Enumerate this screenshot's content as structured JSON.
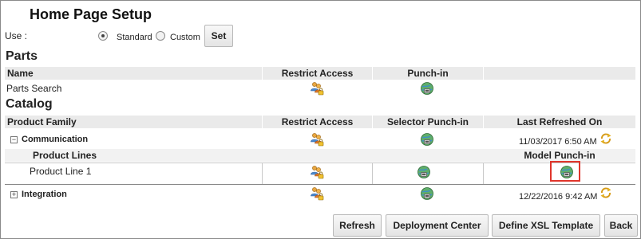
{
  "header": {
    "title": "Home Page Setup"
  },
  "use_row": {
    "label": "Use :",
    "options": [
      {
        "label": "Standard",
        "selected": true
      },
      {
        "label": "Custom",
        "selected": false
      }
    ],
    "set_label": "Set"
  },
  "parts": {
    "title": "Parts",
    "columns": [
      "Name",
      "Restrict Access",
      "Punch-in"
    ],
    "rows": [
      {
        "name": "Parts Search"
      }
    ]
  },
  "catalog": {
    "title": "Catalog",
    "columns": [
      "Product Family",
      "Restrict Access",
      "Selector Punch-in",
      "Last Refreshed On"
    ],
    "families": [
      {
        "name": "Communication",
        "expanded": true,
        "last_refreshed": "11/03/2017 6:50 AM",
        "sub_columns": [
          "Product Lines",
          "Model Punch-in"
        ],
        "lines": [
          {
            "name": "Product Line 1"
          }
        ]
      },
      {
        "name": "Integration",
        "expanded": false,
        "last_refreshed": "12/22/2016 9:42 AM"
      }
    ]
  },
  "buttons": {
    "refresh": "Refresh",
    "deployment_center": "Deployment Center",
    "define_xsl_template": "Define XSL Template",
    "back": "Back"
  },
  "icons": {
    "restrict_access": "users-lock-icon",
    "punch_in": "globe-punch-in-icon",
    "refresh": "refresh-arrows-icon",
    "expand": "plus-box-icon",
    "collapse": "minus-box-icon"
  },
  "colors": {
    "highlight": "#e0352b",
    "header_bg": "#eaeaea"
  }
}
